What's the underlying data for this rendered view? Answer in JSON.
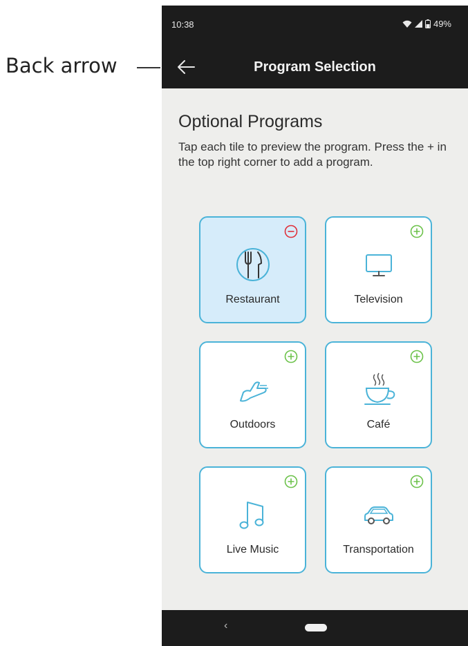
{
  "annotation": {
    "label": "Back arrow"
  },
  "status_bar": {
    "time": "10:38",
    "battery": "49%"
  },
  "app_bar": {
    "title": "Program Selection",
    "back_icon": "arrow-left-icon"
  },
  "main": {
    "heading": "Optional Programs",
    "instructions": "Tap each tile to preview the program. Press the + in the top right corner to add a program.",
    "tiles": [
      {
        "label": "Restaurant",
        "icon": "fork-knife-icon",
        "action": "remove",
        "selected": true
      },
      {
        "label": "Television",
        "icon": "television-icon",
        "action": "add",
        "selected": false
      },
      {
        "label": "Outdoors",
        "icon": "running-shoe-icon",
        "action": "add",
        "selected": false
      },
      {
        "label": "Café",
        "icon": "coffee-cup-icon",
        "action": "add",
        "selected": false
      },
      {
        "label": "Live Music",
        "icon": "music-note-icon",
        "action": "add",
        "selected": false
      },
      {
        "label": "Transportation",
        "icon": "car-icon",
        "action": "add",
        "selected": false
      }
    ]
  },
  "colors": {
    "tile_border": "#4ab3d8",
    "tile_selected_bg": "#d6ecfa",
    "add_badge": "#6cc24a",
    "remove_badge": "#e0303a",
    "bar_bg": "#1c1c1c"
  },
  "nav_bar": {
    "back_glyph": "‹"
  }
}
